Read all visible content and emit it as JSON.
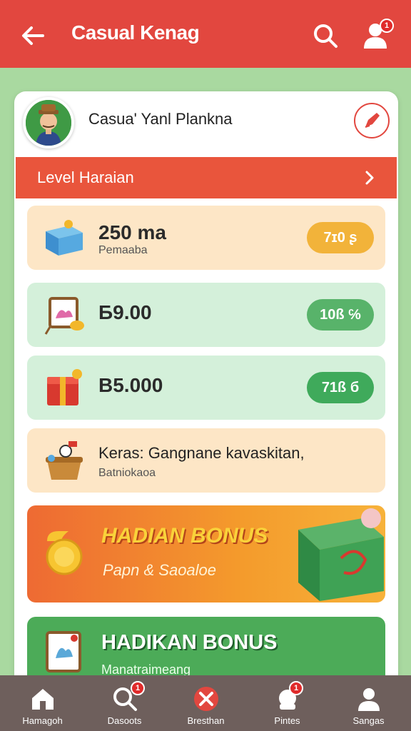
{
  "header": {
    "title": "Casual Kenag",
    "profile_badge": "1"
  },
  "user": {
    "name": "Casua' Yanl Plankna"
  },
  "level": {
    "label": "Level Haraian"
  },
  "rewards": [
    {
      "amount": "250 ma",
      "subtitle": "Pemaaba",
      "pill": "7ɪ0 ʂ",
      "pill_color": "#f2b33a",
      "bg": "#fde6c6",
      "icon": "box-icon"
    },
    {
      "amount": "Б9.00",
      "subtitle": "",
      "pill": "10ß ℅",
      "pill_color": "#58b36a",
      "bg": "#d4f0da",
      "icon": "frame-icon"
    },
    {
      "amount": "B5.000",
      "subtitle": "",
      "pill": "71ß б",
      "pill_color": "#3faa5b",
      "bg": "#d4f0da",
      "icon": "gift-box-icon"
    },
    {
      "amount": "Κeras: Gangnane kavaskitan,",
      "subtitle": "Batniokaoa",
      "pill": "",
      "pill_color": "",
      "bg": "#fde6c6",
      "icon": "basket-icon"
    }
  ],
  "bonus_primary": {
    "title": "HADIAN BONUS",
    "subtitle": "Papn & Saoaloe"
  },
  "bonus_secondary": {
    "title": "HADIKAN BONUS",
    "subtitle": "Manatraimeang"
  },
  "nav": [
    {
      "label": "Hamagoh",
      "icon": "home-icon",
      "badge": ""
    },
    {
      "label": "Dasoots",
      "icon": "search-icon",
      "badge": "1"
    },
    {
      "label": "Bresthan",
      "icon": "close-icon",
      "badge": ""
    },
    {
      "label": "Pintes",
      "icon": "chat-icon",
      "badge": "1"
    },
    {
      "label": "Sangas",
      "icon": "person-icon",
      "badge": ""
    }
  ],
  "colors": {
    "header": "#e2473f",
    "page_bg": "#a9d9a0",
    "accent_orange": "#e9553c",
    "nav_bg": "#6e5f5c"
  }
}
